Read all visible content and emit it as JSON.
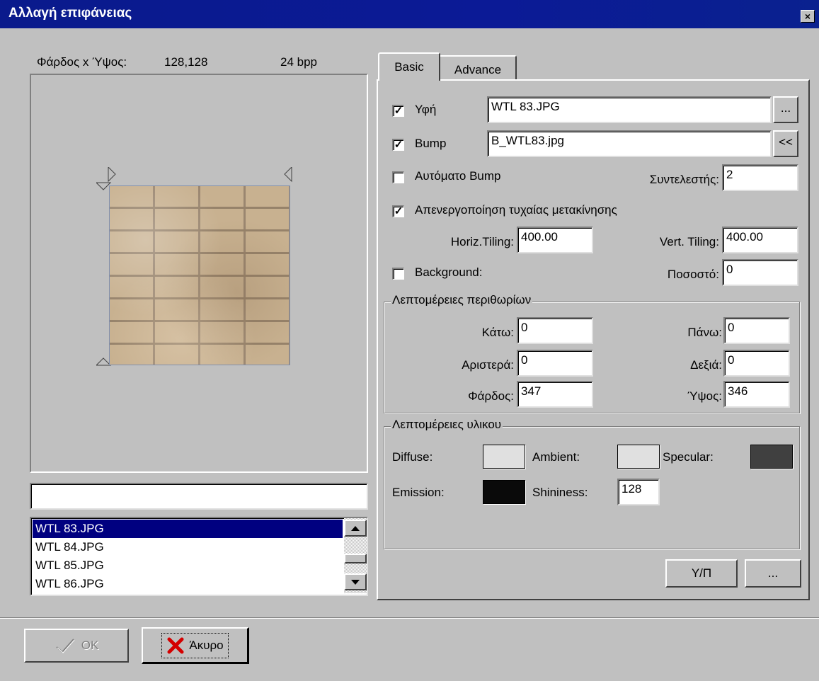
{
  "window": {
    "title": "Αλλαγή επιφάνειας",
    "close_glyph": "×"
  },
  "preview": {
    "size_label": "Φάρδος x Ύψος:",
    "size_value": "128,128",
    "bpp": "24 bpp"
  },
  "filter_input": {
    "value": ""
  },
  "file_list": {
    "items": [
      "WTL 83.JPG",
      "WTL 84.JPG",
      "WTL 85.JPG",
      "WTL 86.JPG"
    ],
    "selected_index": 0
  },
  "tabs": [
    {
      "label": "Basic",
      "active": true
    },
    {
      "label": "Advance",
      "active": false
    }
  ],
  "basic": {
    "texture": {
      "label": "Υφή",
      "checked": true,
      "value": "WTL 83.JPG",
      "browse_label": "..."
    },
    "bump": {
      "label": "Bump",
      "checked": true,
      "value": "B_WTL83.jpg",
      "btn_label": "<<"
    },
    "auto_bump": {
      "label": "Αυτόματο Bump",
      "checked": false
    },
    "factor": {
      "label": "Συντελεστής:",
      "value": "2"
    },
    "disable_random": {
      "label": "Απενεργοποίηση τυχαίας μετακίνησης",
      "checked": true
    },
    "horiz_tiling": {
      "label": "Horiz.Tiling:",
      "value": "400.00"
    },
    "vert_tiling": {
      "label": "Vert. Tiling:",
      "value": "400.00"
    },
    "background": {
      "label": "Background:",
      "checked": false
    },
    "percent": {
      "label": "Ποσοστό:",
      "value": "0"
    }
  },
  "margins": {
    "title": "Λεπτομέρειες περιθωρίων",
    "bottom": {
      "label": "Κάτω:",
      "value": "0"
    },
    "top": {
      "label": "Πάνω:",
      "value": "0"
    },
    "left": {
      "label": "Αριστερά:",
      "value": "0"
    },
    "right": {
      "label": "Δεξιά:",
      "value": "0"
    },
    "width": {
      "label": "Φάρδος:",
      "value": "347"
    },
    "height": {
      "label": "Ύψος:",
      "value": "346"
    }
  },
  "material": {
    "title": "Λεπτομέρειες υλικου",
    "diffuse": {
      "label": "Diffuse:",
      "color": "#e0e0e0"
    },
    "ambient": {
      "label": "Ambient:",
      "color": "#e0e0e0"
    },
    "specular": {
      "label": "Specular:",
      "color": "#404040"
    },
    "emission": {
      "label": "Emission:",
      "color": "#0a0a0a"
    },
    "shininess": {
      "label": "Shininess:",
      "value": "128"
    }
  },
  "panel_buttons": {
    "yp_label": "Υ/Π",
    "more_label": "..."
  },
  "footer": {
    "ok_label": "OK",
    "cancel_label": "Άκυρο"
  }
}
